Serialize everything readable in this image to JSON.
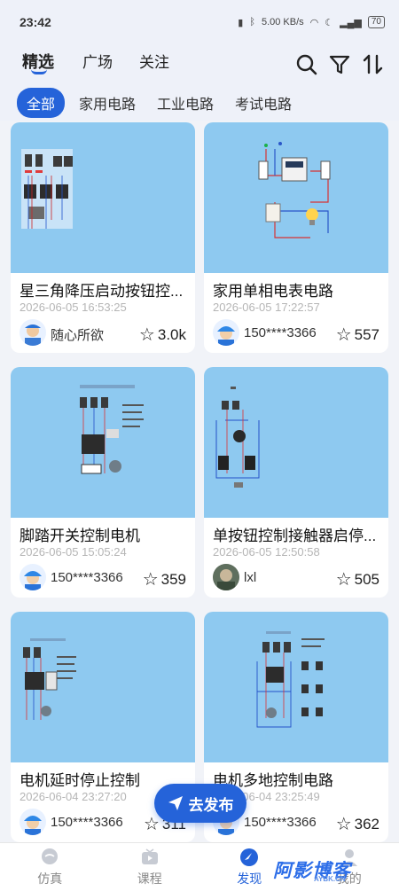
{
  "status_bar": {
    "time": "23:42",
    "net": "5.00 KB/s",
    "battery": "70"
  },
  "top_tabs": [
    "精选",
    "广场",
    "关注"
  ],
  "filters": [
    "全部",
    "家用电路",
    "工业电路",
    "考试电路"
  ],
  "cards": [
    {
      "title": "星三角降压启动按钮控...",
      "date": "2026-06-05 16:53:25",
      "author": "随心所欲",
      "likes": "3.0k",
      "avatar": "worker"
    },
    {
      "title": "家用单相电表电路",
      "date": "2026-06-05 17:22:57",
      "author": "150****3366",
      "likes": "557",
      "avatar": "helmet"
    },
    {
      "title": "脚踏开关控制电机",
      "date": "2026-06-05 15:05:24",
      "author": "150****3366",
      "likes": "359",
      "avatar": "helmet"
    },
    {
      "title": "单按钮控制接触器启停...",
      "date": "2026-06-05 12:50:58",
      "author": "lxl",
      "likes": "505",
      "avatar": "photo"
    },
    {
      "title": "电机延时停止控制",
      "date": "2026-06-04 23:27:20",
      "author": "150****3366",
      "likes": "311",
      "avatar": "helmet"
    },
    {
      "title": "电机多地控制电路",
      "date": "2026-06-04 23:25:49",
      "author": "150****3366",
      "likes": "362",
      "avatar": "helmet"
    }
  ],
  "publish_label": "去发布",
  "bottom_nav": [
    "仿真",
    "课程",
    "发现",
    "我的"
  ],
  "watermark": {
    "main": "阿影博客",
    "sub": "AYBK.CN"
  },
  "colors": {
    "accent": "#2563d9",
    "thumb_bg": "#8ec9f0"
  }
}
